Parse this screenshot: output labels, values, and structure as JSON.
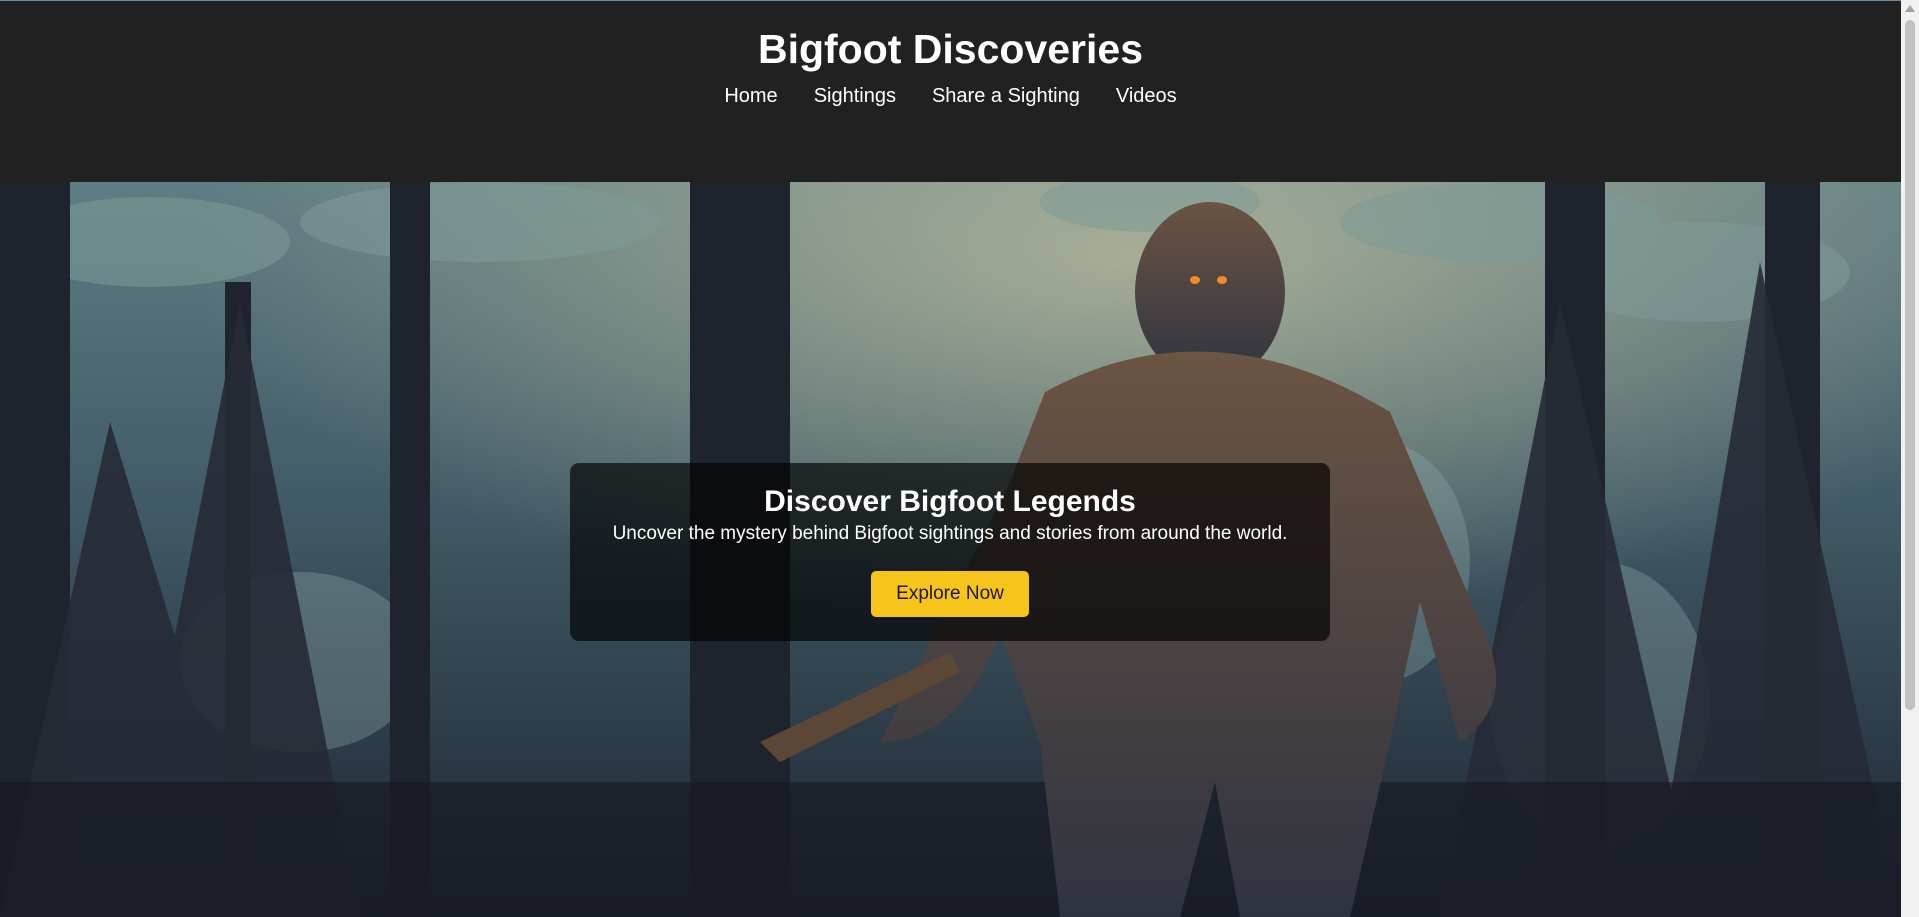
{
  "header": {
    "site_title": "Bigfoot Discoveries",
    "nav": [
      {
        "label": "Home"
      },
      {
        "label": "Sightings"
      },
      {
        "label": "Share a Sighting"
      },
      {
        "label": "Videos"
      }
    ]
  },
  "hero": {
    "title": "Discover Bigfoot Legends",
    "text": "Uncover the mystery behind Bigfoot sightings and stories from around the world.",
    "button_label": "Explore Now",
    "accent_color": "#f6c41a"
  },
  "colors": {
    "header_bg": "#212121",
    "forest_dark": "#1b1c22",
    "forest_mid": "#3e5a66",
    "fur": "#5a4636"
  }
}
